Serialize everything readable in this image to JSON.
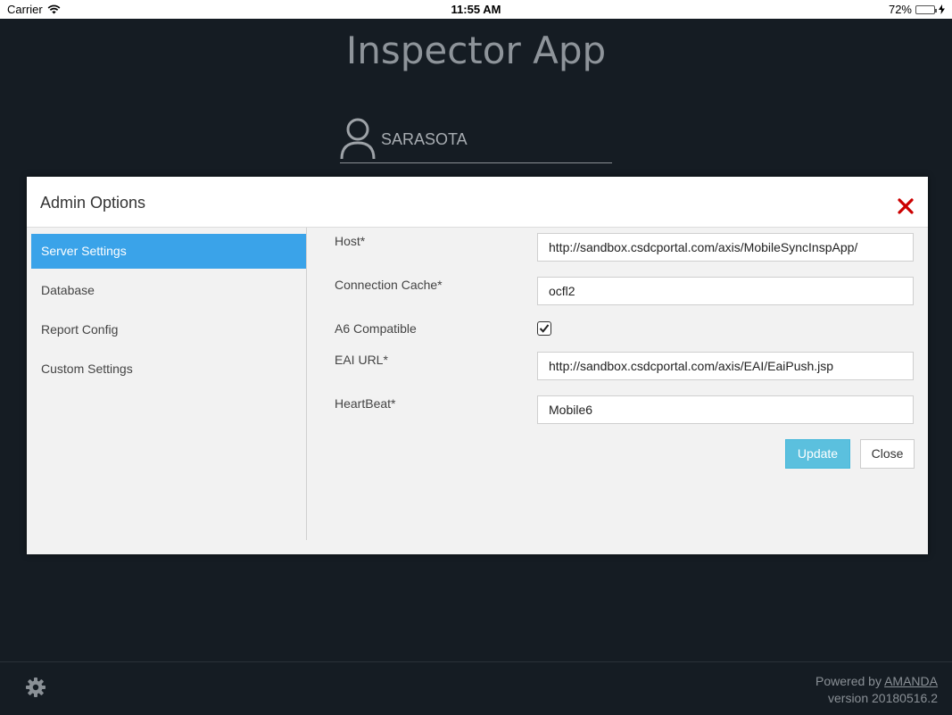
{
  "status_bar": {
    "carrier": "Carrier",
    "time": "11:55 AM",
    "battery": "72%",
    "battery_level": 0.72
  },
  "app": {
    "title": "Inspector App",
    "username": "SARASOTA"
  },
  "modal": {
    "title": "Admin Options",
    "sidebar": [
      {
        "label": "Server Settings",
        "active": true
      },
      {
        "label": "Database",
        "active": false
      },
      {
        "label": "Report Config",
        "active": false
      },
      {
        "label": "Custom Settings",
        "active": false
      }
    ],
    "form": {
      "host_label": "Host*",
      "host_value": "http://sandbox.csdcportal.com/axis/MobileSyncInspApp/",
      "cache_label": "Connection Cache*",
      "cache_value": "ocfl2",
      "a6_label": "A6 Compatible",
      "a6_checked": true,
      "eai_label": "EAI URL*",
      "eai_value": "http://sandbox.csdcportal.com/axis/EAI/EaiPush.jsp",
      "heartbeat_label": "HeartBeat*",
      "heartbeat_value": "Mobile6"
    },
    "buttons": {
      "update": "Update",
      "close": "Close"
    }
  },
  "footer": {
    "powered_by": "Powered by",
    "vendor": "AMANDA",
    "version": "version 20180516.2"
  },
  "colors": {
    "background": "#151c23",
    "accent": "#3aa3e9",
    "update_button": "#5bc0de",
    "close_x": "#cc0000"
  },
  "icons": [
    "wifi-icon",
    "battery-icon",
    "charging-icon",
    "user-icon",
    "close-icon",
    "checkmark-icon",
    "gear-icon"
  ]
}
